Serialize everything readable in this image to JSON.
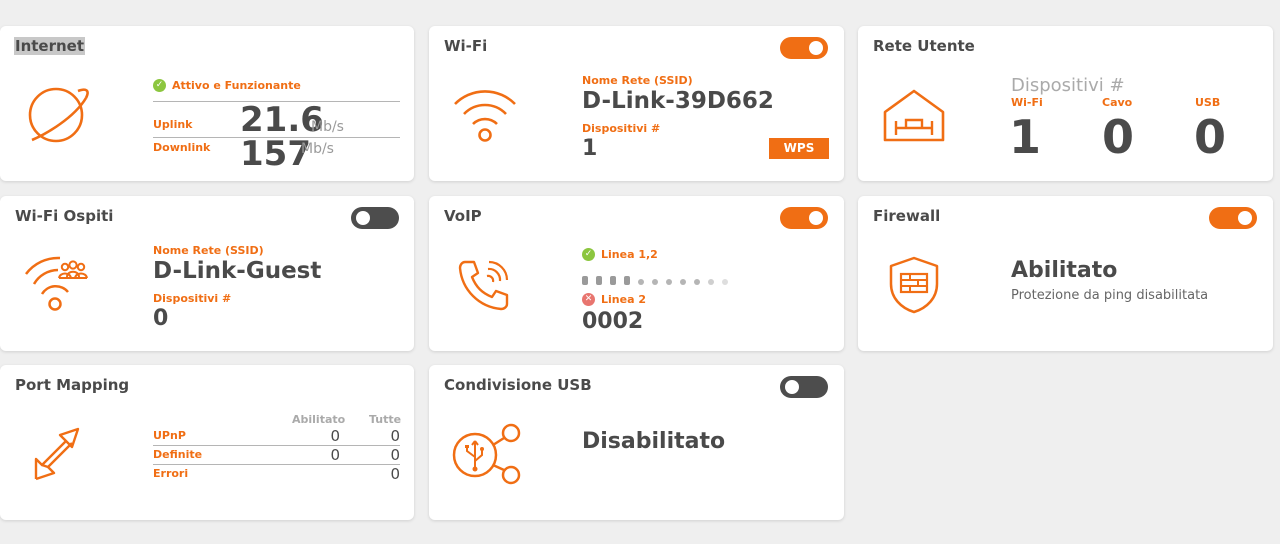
{
  "colors": {
    "accent": "#f06e14",
    "ok": "#8cc63f",
    "error": "#e8756f",
    "toggle_off": "#4d4d4d"
  },
  "internet": {
    "title": "Internet",
    "status": "Attivo e Funzionante",
    "uplink_label": "Uplink",
    "uplink_value": "21.6",
    "uplink_unit": "Mb/s",
    "downlink_label": "Downlink",
    "downlink_value": "157",
    "downlink_unit": "Mb/s",
    "icon": "planet-icon"
  },
  "wifi": {
    "title": "Wi-Fi",
    "toggle": true,
    "ssid_label": "Nome Rete (SSID)",
    "ssid": "D-Link-39D662",
    "devices_label": "Dispositivi #",
    "devices": "1",
    "wps_label": "WPS",
    "icon": "wifi-icon"
  },
  "rete_utente": {
    "title": "Rete Utente",
    "devices_label": "Dispositivi #",
    "cols": [
      {
        "label": "Wi-Fi",
        "value": "1"
      },
      {
        "label": "Cavo",
        "value": "0"
      },
      {
        "label": "USB",
        "value": "0"
      }
    ],
    "icon": "home-network-icon"
  },
  "wifi_ospiti": {
    "title": "Wi-Fi Ospiti",
    "toggle": false,
    "ssid_label": "Nome Rete (SSID)",
    "ssid": "D-Link-Guest",
    "devices_label": "Dispositivi #",
    "devices": "0",
    "icon": "guest-wifi-icon"
  },
  "voip": {
    "title": "VoIP",
    "toggle": true,
    "line1_label": "Linea 1,2",
    "line1_value": "",
    "line2_label": "Linea 2",
    "line2_value": "0002",
    "icon": "phone-icon"
  },
  "firewall": {
    "title": "Firewall",
    "toggle": true,
    "status": "Abilitato",
    "detail": "Protezione da ping disabilitata",
    "icon": "firewall-shield-icon"
  },
  "port_mapping": {
    "title": "Port Mapping",
    "col1": "Abilitato",
    "col2": "Tutte",
    "rows": [
      {
        "label": "UPnP",
        "enabled": "0",
        "all": "0"
      },
      {
        "label": "Definite",
        "enabled": "0",
        "all": "0"
      },
      {
        "label": "Errori",
        "enabled": "",
        "all": "0"
      }
    ],
    "icon": "port-arrows-icon"
  },
  "usb": {
    "title": "Condivisione USB",
    "toggle": false,
    "status": "Disabilitato",
    "icon": "usb-share-icon"
  }
}
